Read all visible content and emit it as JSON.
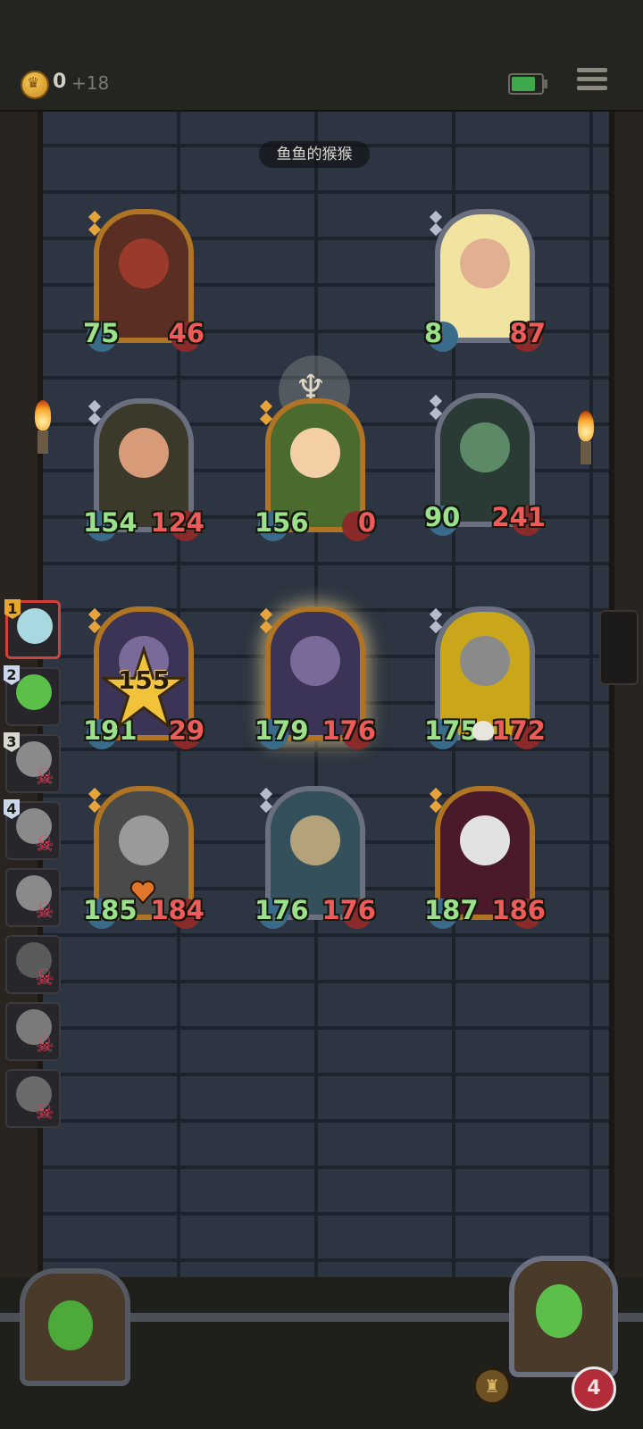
{
  "header": {
    "gold": "0",
    "gold_income": "+18",
    "battery_level": 0.8
  },
  "banner": "鱼鱼的猴猴",
  "board": {
    "cards": [
      {
        "id": "dragon",
        "atk": "75",
        "hp": "46",
        "frame": "gold",
        "face": "#9a3a2a",
        "bg": "#5a2e22"
      },
      {
        "id": "dwarf",
        "atk": "8",
        "hp": "87",
        "frame": "silver",
        "face": "#e0b090",
        "bg": "#f1e4a0"
      },
      {
        "id": "brute",
        "atk": "154",
        "hp": "124",
        "frame": "silver",
        "face": "#d79b7a",
        "bg": "#3b3a2a"
      },
      {
        "id": "leaf-girl",
        "atk": "156",
        "hp": "0",
        "frame": "gold",
        "face": "#f4cfa5",
        "bg": "#4a6a2e"
      },
      {
        "id": "beast",
        "atk": "90",
        "hp": "241",
        "frame": "silver",
        "face": "#5c8a66",
        "bg": "#2a3a34"
      },
      {
        "id": "knight-star",
        "atk": "191",
        "hp": "29",
        "frame": "gold",
        "face": "#7a6a9a",
        "bg": "#3c3456",
        "star": "155"
      },
      {
        "id": "knight",
        "atk": "179",
        "hp": "176",
        "frame": "gold",
        "face": "#7a6a9a",
        "bg": "#3c3456"
      },
      {
        "id": "robot-lightning",
        "atk": "175",
        "hp": "172",
        "frame": "silver",
        "face": "#8a8a8a",
        "bg": "#caa61a"
      },
      {
        "id": "robot-heart",
        "atk": "185",
        "hp": "184",
        "frame": "gold",
        "face": "#9a9a9a",
        "bg": "#4a4a4a"
      },
      {
        "id": "werewolf",
        "atk": "176",
        "hp": "176",
        "frame": "silver",
        "face": "#b3a27a",
        "bg": "#34505a"
      },
      {
        "id": "clown",
        "atk": "187",
        "hp": "186",
        "frame": "gold",
        "face": "#e2e2e2",
        "bg": "#4a1a2a"
      }
    ]
  },
  "roster": {
    "slots": [
      {
        "num": "1",
        "style": "gold",
        "face": "#a8d8e0",
        "dead": false,
        "active": true
      },
      {
        "num": "2",
        "style": "blue",
        "face": "#5cbf4a",
        "dead": false,
        "active": false
      },
      {
        "num": "3",
        "style": "white",
        "face": "#8a8a8a",
        "dead": true,
        "active": false
      },
      {
        "num": "4",
        "style": "blue",
        "face": "#8a8a8a",
        "dead": true,
        "active": false
      },
      {
        "num": "",
        "style": "",
        "face": "#8a8a8a",
        "dead": true,
        "active": false
      },
      {
        "num": "",
        "style": "",
        "face": "#5a5a5a",
        "dead": true,
        "active": false
      },
      {
        "num": "",
        "style": "",
        "face": "#7a7a7a",
        "dead": true,
        "active": false
      },
      {
        "num": "",
        "style": "",
        "face": "#6a6a6a",
        "dead": true,
        "active": false
      }
    ],
    "skull_glyph": "☠"
  },
  "player": {
    "lives": "4",
    "bell_glyph": "♜"
  }
}
